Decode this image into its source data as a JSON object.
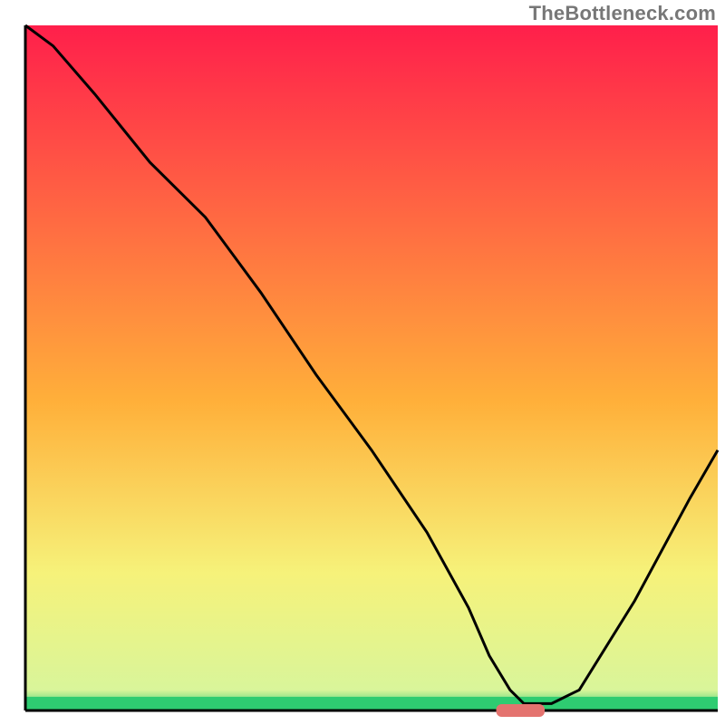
{
  "watermark": "TheBottleneck.com",
  "chart_data": {
    "type": "line",
    "title": "",
    "xlabel": "",
    "ylabel": "",
    "xlim": [
      0,
      100
    ],
    "ylim": [
      0,
      100
    ],
    "x": [
      0,
      4,
      10,
      18,
      26,
      34,
      42,
      50,
      58,
      64,
      67,
      70,
      72,
      76,
      80,
      88,
      96,
      100
    ],
    "values": [
      100,
      97,
      90,
      80,
      72,
      61,
      49,
      38,
      26,
      15,
      8,
      3,
      1,
      1,
      3,
      16,
      31,
      38
    ],
    "marker": {
      "x_start": 68,
      "x_end": 75,
      "y": 0,
      "color": "#e4736f"
    },
    "green_band": {
      "y_start": 0,
      "y_end": 2
    },
    "gradient": [
      "#ff1f4b",
      "#ffd23b",
      "#f6f27a",
      "#2ecc71"
    ],
    "axis_color": "#000000",
    "curve_color": "#000000"
  }
}
